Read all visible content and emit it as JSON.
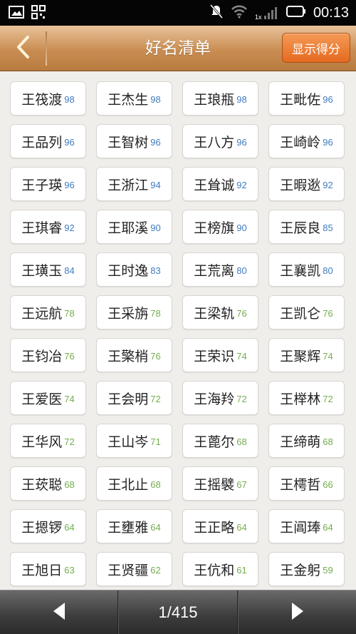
{
  "status_bar": {
    "time": "00:13",
    "network_label": "1x",
    "icons": [
      "image-icon",
      "qr-icon",
      "mute-icon",
      "wifi-icon",
      "signal-icon",
      "battery-icon"
    ]
  },
  "header": {
    "title": "好名清单",
    "score_button": "显示得分",
    "back_icon": "chevron-left-icon",
    "accent_color": "#c98d52"
  },
  "names": [
    {
      "name": "王筏渡",
      "score": "98"
    },
    {
      "name": "王杰生",
      "score": "98"
    },
    {
      "name": "王琅瓶",
      "score": "98"
    },
    {
      "name": "王毗佐",
      "score": "96"
    },
    {
      "name": "王品列",
      "score": "96"
    },
    {
      "name": "王智树",
      "score": "96"
    },
    {
      "name": "王八方",
      "score": "96"
    },
    {
      "name": "王崎岭",
      "score": "96"
    },
    {
      "name": "王子瑛",
      "score": "96"
    },
    {
      "name": "王浙江",
      "score": "94"
    },
    {
      "name": "王耸诚",
      "score": "92"
    },
    {
      "name": "王暇逖",
      "score": "92"
    },
    {
      "name": "王琪睿",
      "score": "92"
    },
    {
      "name": "王耶溪",
      "score": "90"
    },
    {
      "name": "王榜旗",
      "score": "90"
    },
    {
      "name": "王辰良",
      "score": "85"
    },
    {
      "name": "王璜玉",
      "score": "84"
    },
    {
      "name": "王时逸",
      "score": "83"
    },
    {
      "name": "王荒离",
      "score": "80"
    },
    {
      "name": "王襄凯",
      "score": "80"
    },
    {
      "name": "王远航",
      "score": "78"
    },
    {
      "name": "王采旃",
      "score": "78"
    },
    {
      "name": "王梁轨",
      "score": "76"
    },
    {
      "name": "王凯仑",
      "score": "76"
    },
    {
      "name": "王钧冶",
      "score": "76"
    },
    {
      "name": "王檠梢",
      "score": "76"
    },
    {
      "name": "王荣识",
      "score": "74"
    },
    {
      "name": "王聚辉",
      "score": "74"
    },
    {
      "name": "王爱医",
      "score": "74"
    },
    {
      "name": "王会明",
      "score": "72"
    },
    {
      "name": "王海羚",
      "score": "72"
    },
    {
      "name": "王榉林",
      "score": "72"
    },
    {
      "name": "王华风",
      "score": "72"
    },
    {
      "name": "王山岑",
      "score": "71"
    },
    {
      "name": "王蓖尔",
      "score": "68"
    },
    {
      "name": "王缔萌",
      "score": "68"
    },
    {
      "name": "王莰聪",
      "score": "68"
    },
    {
      "name": "王北止",
      "score": "68"
    },
    {
      "name": "王摇襞",
      "score": "67"
    },
    {
      "name": "王樗哲",
      "score": "66"
    },
    {
      "name": "王摁锣",
      "score": "64"
    },
    {
      "name": "王壅雅",
      "score": "64"
    },
    {
      "name": "王正略",
      "score": "64"
    },
    {
      "name": "王阊琫",
      "score": "64"
    },
    {
      "name": "王旭日",
      "score": "63"
    },
    {
      "name": "王贤疆",
      "score": "62"
    },
    {
      "name": "王伉和",
      "score": "61"
    },
    {
      "name": "王金躬",
      "score": "59"
    }
  ],
  "score_colors": {
    "high": "#3f7cc0",
    "low": "#74ad4d"
  },
  "pagination": {
    "page_text": "1/415",
    "prev_icon": "triangle-left-icon",
    "next_icon": "triangle-right-icon"
  }
}
